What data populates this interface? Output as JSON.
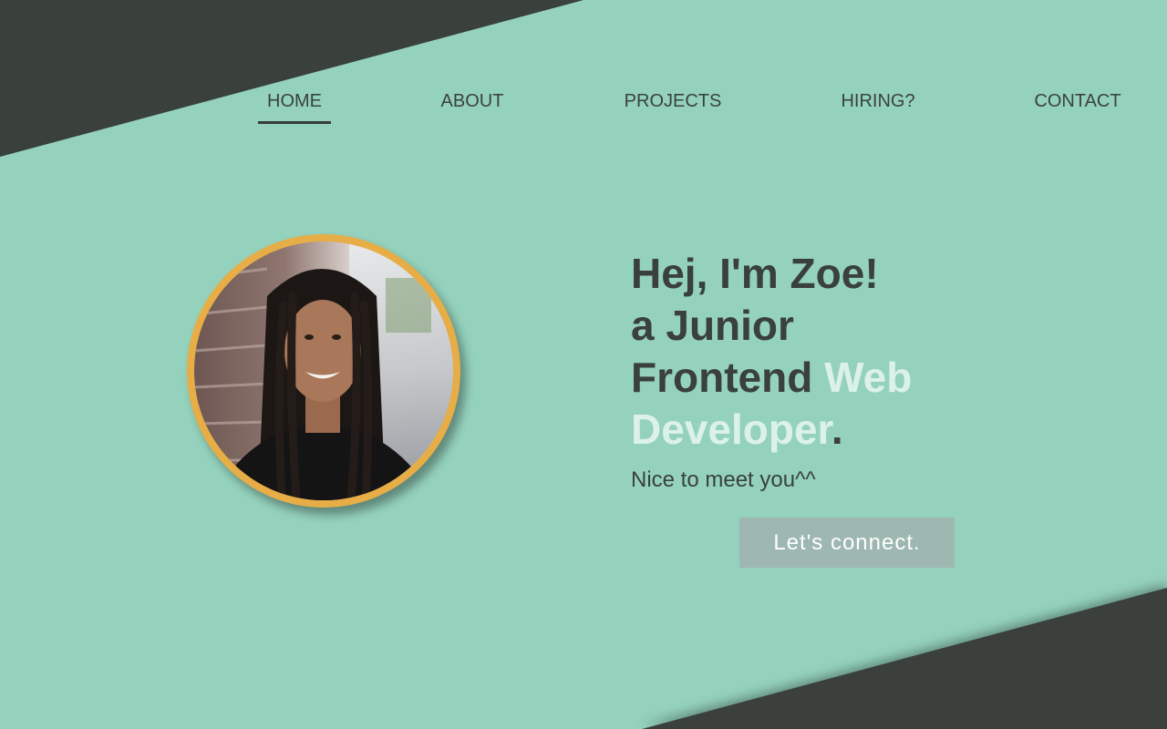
{
  "nav": {
    "items": [
      {
        "label": "HOME",
        "active": true
      },
      {
        "label": "ABOUT",
        "active": false
      },
      {
        "label": "PROJECTS",
        "active": false
      },
      {
        "label": "HIRING?",
        "active": false
      },
      {
        "label": "CONTACT",
        "active": false
      }
    ]
  },
  "hero": {
    "line1": "Hej, I'm Zoe!",
    "line2": "a Junior",
    "line3_plain": "Frontend ",
    "line3_accent": "Web",
    "line4_accent": "Developer",
    "line4_end": ".",
    "subline": "Nice to meet you^^",
    "cta_label": "Let's connect."
  },
  "colors": {
    "background": "#94d2bd",
    "dark": "#363d39",
    "accent_text": "#dcf1ec",
    "avatar_ring": "#e7ad46",
    "cta_background": "#9eb7b1"
  },
  "icons": {
    "avatar": "profile-photo"
  }
}
